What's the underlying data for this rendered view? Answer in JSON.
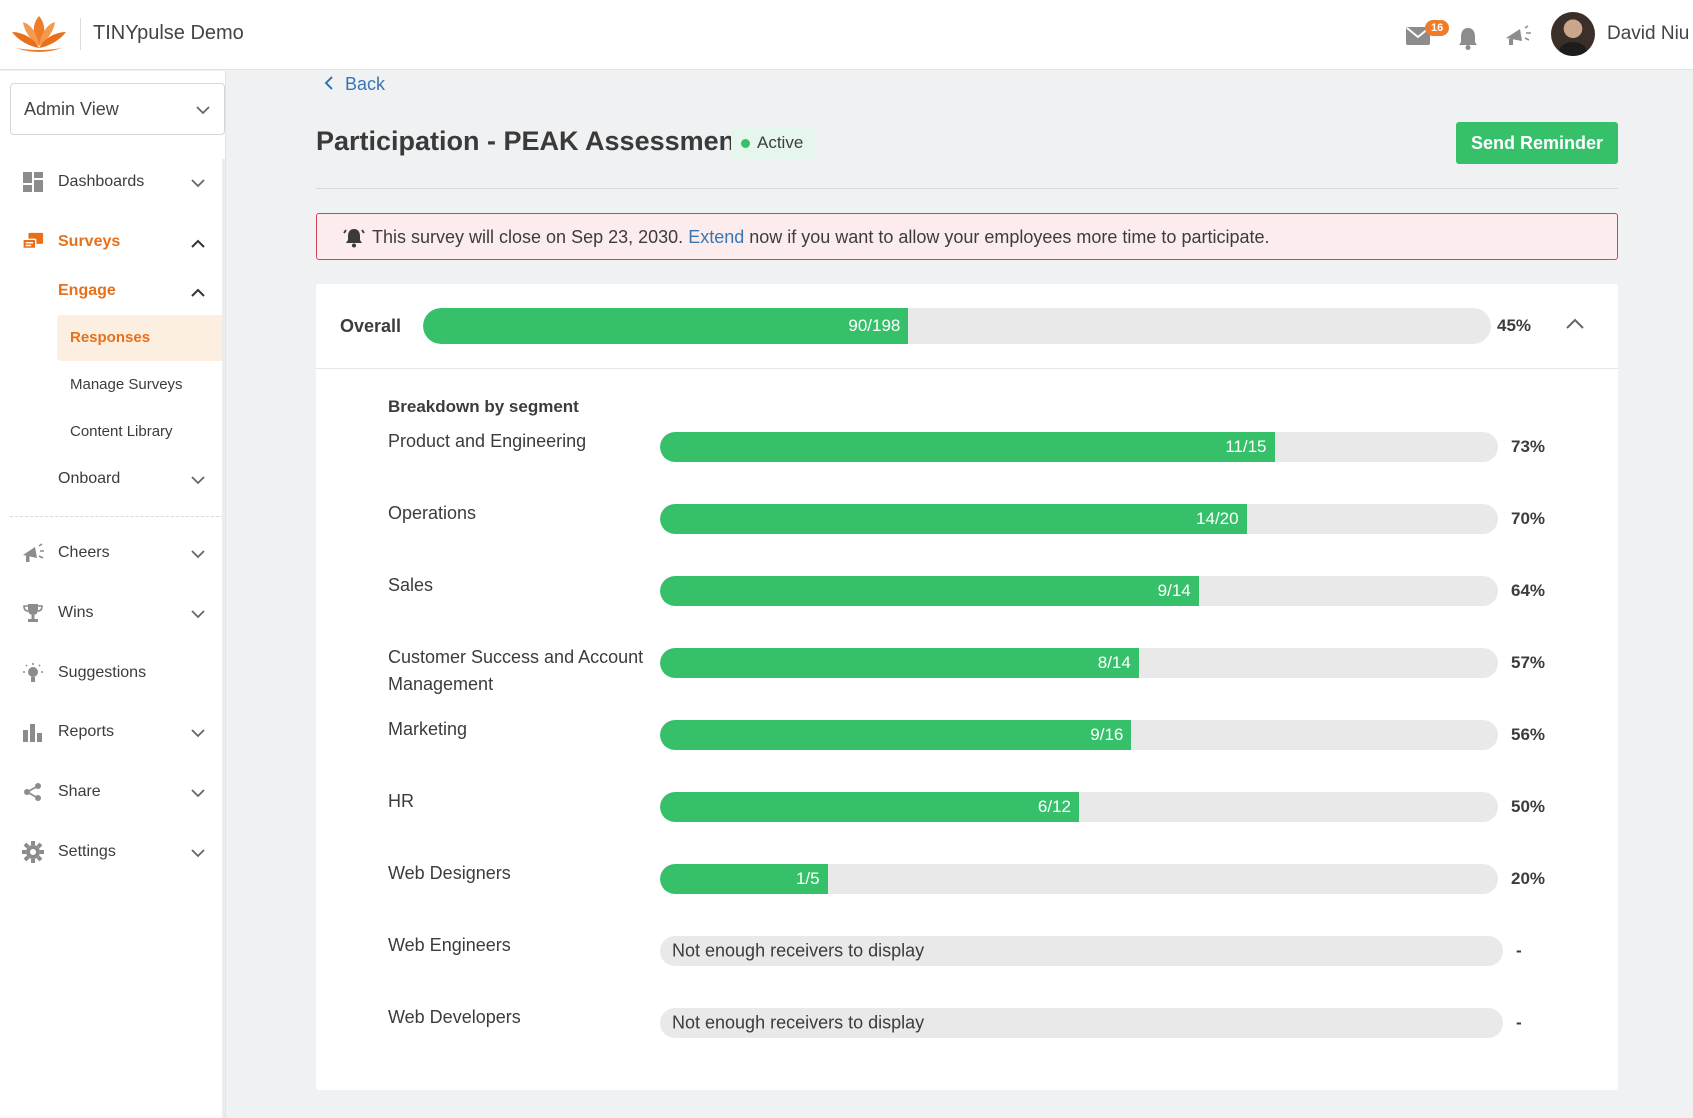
{
  "header": {
    "app_title": "TINYpulse Demo",
    "mail_count": "16",
    "user_name": "David Niu",
    "brand_color": "#f07c2a"
  },
  "sidebar": {
    "view_select": "Admin View",
    "items": [
      {
        "label": "Dashboards",
        "icon": "dashboard-icon"
      },
      {
        "label": "Surveys",
        "icon": "survey-icon"
      },
      {
        "label": "Engage"
      },
      {
        "label": "Responses"
      },
      {
        "label": "Manage Surveys"
      },
      {
        "label": "Content Library"
      },
      {
        "label": "Onboard"
      },
      {
        "label": "Cheers",
        "icon": "megaphone-icon"
      },
      {
        "label": "Wins",
        "icon": "trophy-icon"
      },
      {
        "label": "Suggestions",
        "icon": "lightbulb-icon"
      },
      {
        "label": "Reports",
        "icon": "bar-chart-icon"
      },
      {
        "label": "Share",
        "icon": "share-icon"
      },
      {
        "label": "Settings",
        "icon": "gear-icon"
      }
    ]
  },
  "main": {
    "back_label": "Back",
    "title": "Participation - PEAK Assessment",
    "status": "Active",
    "send_reminder": "Send Reminder",
    "alert": {
      "before": "This survey will close on Sep 23, 2030.",
      "link": "Extend",
      "after": "now if you want to allow your employees more time to participate."
    },
    "overall": {
      "label": "Overall",
      "count": "90/198",
      "percent": "45%",
      "fraction": 0.4545
    },
    "breakdown_title": "Breakdown by segment",
    "segments": [
      {
        "name": "Product and Engineering",
        "count": "11/15",
        "percent": "73%",
        "fraction": 0.7333
      },
      {
        "name": "Operations",
        "count": "14/20",
        "percent": "70%",
        "fraction": 0.7
      },
      {
        "name": "Sales",
        "count": "9/14",
        "percent": "64%",
        "fraction": 0.6429
      },
      {
        "name": "Customer Success and Account Management",
        "count": "8/14",
        "percent": "57%",
        "fraction": 0.5714
      },
      {
        "name": "Marketing",
        "count": "9/16",
        "percent": "56%",
        "fraction": 0.5625
      },
      {
        "name": "HR",
        "count": "6/12",
        "percent": "50%",
        "fraction": 0.5
      },
      {
        "name": "Web Designers",
        "count": "1/5",
        "percent": "20%",
        "fraction": 0.2
      },
      {
        "name": "Web Engineers",
        "empty_text": "Not enough receivers to display",
        "percent": "-"
      },
      {
        "name": "Web Developers",
        "empty_text": "Not enough receivers to display",
        "percent": "-"
      }
    ],
    "accent_color": "#37c06a",
    "alert_color": "#d9415a",
    "link_color": "#3776b5"
  }
}
